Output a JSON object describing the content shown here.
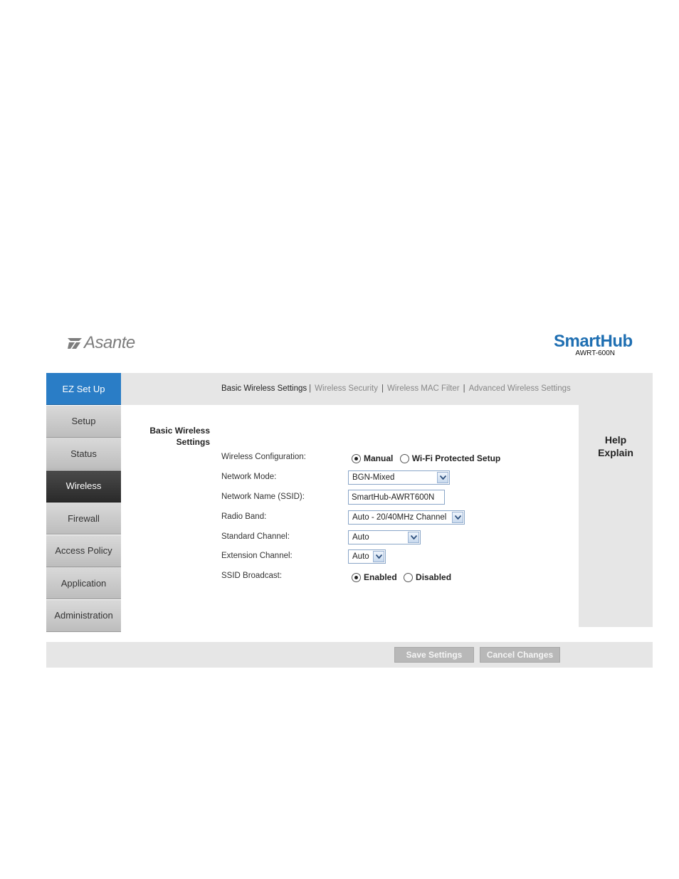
{
  "brand": {
    "logo_text": "Asante",
    "product": "SmartHub",
    "model": "AWRT-600N"
  },
  "sidebar": {
    "items": [
      {
        "label": "EZ Set Up"
      },
      {
        "label": "Setup"
      },
      {
        "label": "Status"
      },
      {
        "label": "Wireless"
      },
      {
        "label": "Firewall"
      },
      {
        "label": "Access Policy"
      },
      {
        "label": "Application"
      },
      {
        "label": "Administration"
      }
    ],
    "active": "Wireless"
  },
  "tabs": {
    "items": [
      {
        "label": "Basic Wireless Settings"
      },
      {
        "label": "Wireless Security"
      },
      {
        "label": "Wireless MAC Filter"
      },
      {
        "label": "Advanced Wireless Settings"
      }
    ],
    "current": "Basic Wireless Settings"
  },
  "section": {
    "title_line1": "Basic Wireless",
    "title_line2": "Settings"
  },
  "form": {
    "wireless_config": {
      "label": "Wireless Configuration:",
      "opt_manual": "Manual",
      "opt_wps": "Wi-Fi Protected Setup",
      "selected": "Manual"
    },
    "network_mode": {
      "label": "Network Mode:",
      "value": "BGN-Mixed"
    },
    "ssid": {
      "label": "Network Name (SSID):",
      "value": "SmartHub-AWRT600N"
    },
    "radio_band": {
      "label": "Radio Band:",
      "value": "Auto - 20/40MHz Channel"
    },
    "standard_channel": {
      "label": "Standard Channel:",
      "value": "Auto"
    },
    "extension_channel": {
      "label": "Extension Channel:",
      "value": "Auto"
    },
    "ssid_broadcast": {
      "label": "SSID Broadcast:",
      "opt_enabled": "Enabled",
      "opt_disabled": "Disabled",
      "selected": "Enabled"
    }
  },
  "help": {
    "line1": "Help",
    "line2": "Explain"
  },
  "footer": {
    "save_label": "Save Settings",
    "cancel_label": "Cancel Changes"
  },
  "colors": {
    "brand_blue": "#2a7dc6",
    "active_nav": "#333333",
    "panel_gray": "#e6e6e6"
  }
}
